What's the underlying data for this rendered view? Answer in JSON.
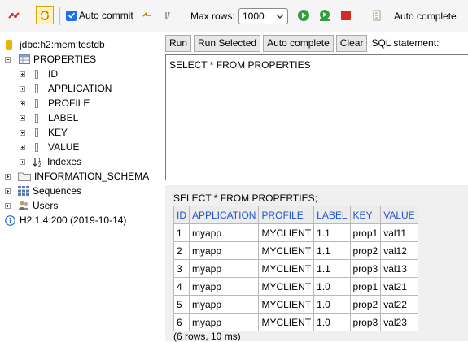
{
  "toolbar": {
    "auto_commit_label": "Auto commit",
    "max_rows_label": "Max rows:",
    "max_rows_value": "1000",
    "auto_complete_label": "Auto complete"
  },
  "tree": {
    "connection": "jdbc:h2:mem:testdb",
    "table": "PROPERTIES",
    "columns": [
      "ID",
      "APPLICATION",
      "PROFILE",
      "LABEL",
      "KEY",
      "VALUE"
    ],
    "indexes_label": "Indexes",
    "info_schema": "INFORMATION_SCHEMA",
    "sequences": "Sequences",
    "users": "Users",
    "version": "H2 1.4.200 (2019-10-14)"
  },
  "buttons": {
    "run": "Run",
    "run_selected": "Run Selected",
    "auto_complete": "Auto complete",
    "clear": "Clear",
    "sql_statement_label": "SQL statement:"
  },
  "editor": {
    "text": "SELECT * FROM PROPERTIES"
  },
  "result": {
    "query": "SELECT * FROM PROPERTIES;",
    "columns": [
      "ID",
      "APPLICATION",
      "PROFILE",
      "LABEL",
      "KEY",
      "VALUE"
    ],
    "rows": [
      [
        "1",
        "myapp",
        "MYCLIENT",
        "1.1",
        "prop1",
        "val11"
      ],
      [
        "2",
        "myapp",
        "MYCLIENT",
        "1.1",
        "prop2",
        "val12"
      ],
      [
        "3",
        "myapp",
        "MYCLIENT",
        "1.1",
        "prop3",
        "val13"
      ],
      [
        "4",
        "myapp",
        "MYCLIENT",
        "1.0",
        "prop1",
        "val21"
      ],
      [
        "5",
        "myapp",
        "MYCLIENT",
        "1.0",
        "prop2",
        "val22"
      ],
      [
        "6",
        "myapp",
        "MYCLIENT",
        "1.0",
        "prop3",
        "val23"
      ]
    ],
    "footer": "(6 rows, 10 ms)"
  }
}
